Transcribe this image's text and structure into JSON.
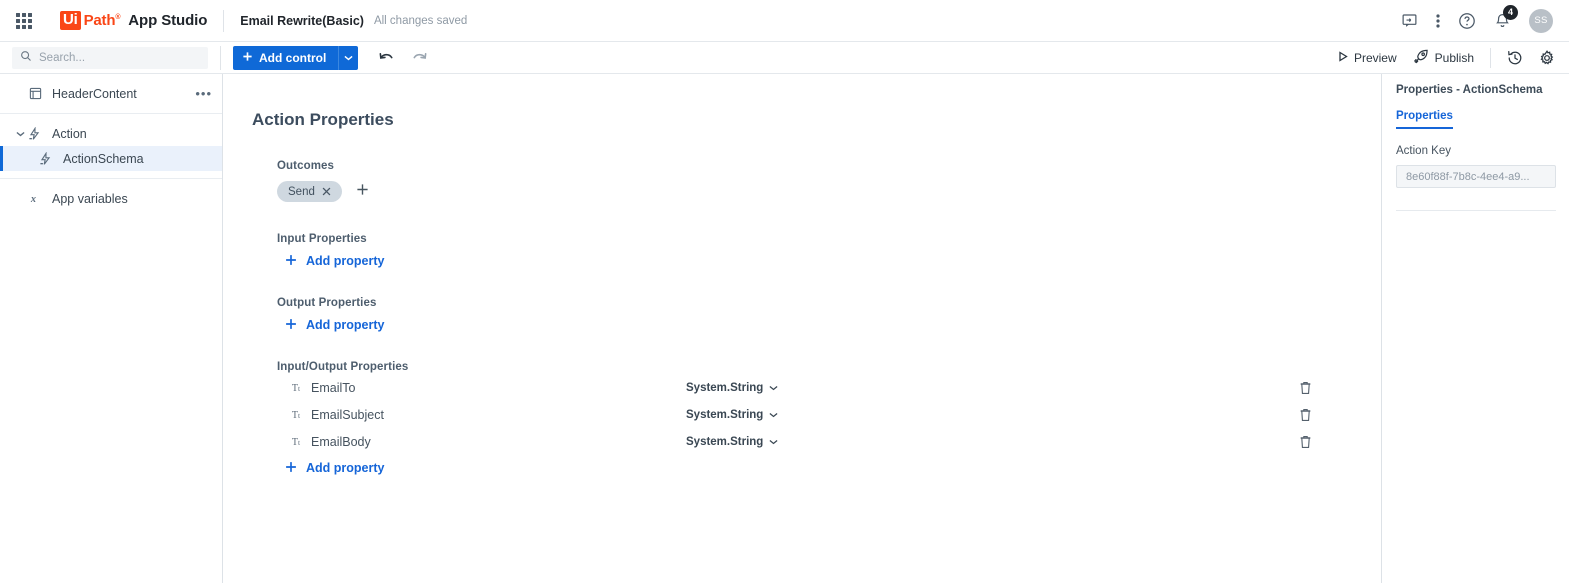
{
  "topbar": {
    "apps_icon": "app-grid-icon",
    "brand_ui": "Ui",
    "brand_path": "Path",
    "brand_product": "App Studio",
    "project_name": "Email Rewrite(Basic)",
    "save_status": "All changes saved",
    "icons": {
      "feedback": "feedback-icon",
      "more": "more-vertical-icon",
      "help": "help-circle-icon",
      "notifications": "bell-icon",
      "avatar": "avatar"
    },
    "notification_count": "4",
    "avatar_initials": "SS"
  },
  "toolbar": {
    "search_placeholder": "Search...",
    "search_value": "",
    "add_control_label": "Add control",
    "undo_label": "undo-icon",
    "redo_label": "redo-icon",
    "preview_label": "Preview",
    "publish_label": "Publish",
    "history_icon": "history-icon",
    "settings_icon": "gear-icon"
  },
  "sidebar": {
    "items": [
      {
        "label": "HeaderContent",
        "icon": "layout-icon",
        "selected": false,
        "has_more": true,
        "indent": 0
      },
      {
        "label": "Action",
        "icon": "action-icon",
        "selected": false,
        "has_more": false,
        "indent": 0,
        "expanded": true
      },
      {
        "label": "ActionSchema",
        "icon": "action-icon",
        "selected": true,
        "has_more": false,
        "indent": 1
      },
      {
        "label": "App variables",
        "icon": "variable-icon",
        "selected": false,
        "has_more": false,
        "indent": 0
      }
    ]
  },
  "main": {
    "page_title": "Action Properties",
    "outcomes": {
      "label": "Outcomes",
      "chips": [
        {
          "label": "Send"
        }
      ],
      "add_icon": "plus-icon"
    },
    "input_properties": {
      "label": "Input Properties",
      "add_label": "Add property",
      "rows": []
    },
    "output_properties": {
      "label": "Output Properties",
      "add_label": "Add property",
      "rows": []
    },
    "input_output_properties": {
      "label": "Input/Output Properties",
      "add_label": "Add property",
      "rows": [
        {
          "icon": "text-type-icon",
          "name": "EmailTo",
          "type": "System.String",
          "delete_icon": "trash-icon"
        },
        {
          "icon": "text-type-icon",
          "name": "EmailSubject",
          "type": "System.String",
          "delete_icon": "trash-icon"
        },
        {
          "icon": "text-type-icon",
          "name": "EmailBody",
          "type": "System.String",
          "delete_icon": "trash-icon"
        }
      ]
    }
  },
  "right_panel": {
    "title": "Properties - ActionSchema",
    "tab_label": "Properties",
    "action_key_label": "Action Key",
    "action_key_value": "8e60f88f-7b8c-4ee4-a9..."
  },
  "colors": {
    "accent_blue": "#0f69d7",
    "link_blue": "#1565d8",
    "brand_orange": "#fa4616",
    "selection_bg": "#eaf1fb",
    "chip_bg": "#cfd8e0",
    "text_dark": "#37474f"
  }
}
